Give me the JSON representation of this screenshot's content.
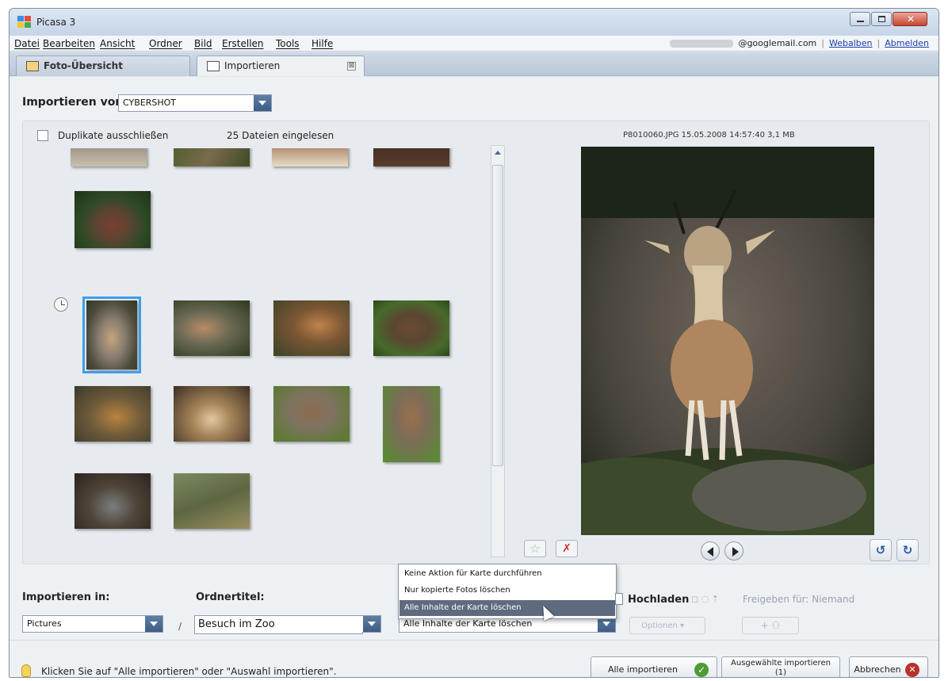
{
  "window": {
    "title": "Picasa 3"
  },
  "menu": {
    "items": [
      "Datei",
      "Bearbeiten",
      "Ansicht",
      "Ordner",
      "Bild",
      "Erstellen",
      "Tools",
      "Hilfe"
    ]
  },
  "account": {
    "email": "@googlemail.com",
    "web_albums": "Webalben",
    "separator": "|",
    "logout": "Abmelden"
  },
  "tabs": [
    {
      "label": "Foto-Übersicht",
      "icon": "photo-overview-icon"
    },
    {
      "label": "Importieren",
      "icon": "import-camera-icon",
      "close": "⊠"
    }
  ],
  "import_from": {
    "label": "Importieren von",
    "device": "CYBERSHOT"
  },
  "options": {
    "exclude_duplicates": "Duplikate ausschließen",
    "exclude_duplicates_checked": false,
    "files_loaded": "25 Dateien eingelesen"
  },
  "preview": {
    "file_info": "P8010060.JPG   15.05.2008 14:57:40   3,1 MB"
  },
  "colors": {
    "accent_blue": "#3d9ee8",
    "dropdown_highlight": "#5e6b7f",
    "ok_green": "#4e9a35",
    "cancel_red": "#b8312b"
  },
  "import_to": {
    "label": "Importieren in:",
    "folder": "Pictures",
    "separator": "/"
  },
  "folder_title": {
    "label": "Ordnertitel:",
    "value": "Besuch im Zoo"
  },
  "card_action": {
    "selected": "Alle Inhalte der Karte löschen",
    "menu": [
      "Keine Aktion für Karte durchführen",
      "Nur kopierte Fotos löschen",
      "Alle Inhalte der Karte löschen"
    ],
    "highlighted_index": 2
  },
  "upload": {
    "label": "Hochladen",
    "share": "Freigeben für: Niemand",
    "options": "Optionen"
  },
  "status": {
    "hint": "Klicken Sie auf \"Alle importieren\" oder \"Auswahl importieren\"."
  },
  "buttons": {
    "import_all": "Alle importieren",
    "import_selected": "Ausgewählte importieren",
    "import_selected_count": "(1)",
    "cancel": "Abbrechen"
  }
}
